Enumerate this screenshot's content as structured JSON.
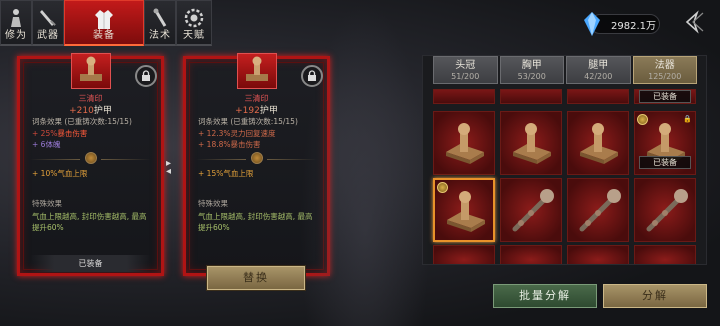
{
  "nav": {
    "tabs": [
      {
        "label": "修为",
        "icon": "figure-icon"
      },
      {
        "label": "武器",
        "icon": "sword-icon"
      },
      {
        "label": "装备",
        "icon": "robe-icon"
      },
      {
        "label": "法术",
        "icon": "staff-icon"
      },
      {
        "label": "天赋",
        "icon": "gear-icon"
      }
    ],
    "active_index": 2
  },
  "currency": {
    "amount": "2982.1万",
    "icon": "blue-crystal-icon"
  },
  "cards": [
    {
      "name": "三清印",
      "armor_value": "+210",
      "armor_label": "护甲",
      "affix_header": "词条效果 (已重铸次数:15/15)",
      "stat1_prefix": "+ 25%",
      "stat1_em": "暴击伤害",
      "stat2": "+ 6体魄",
      "set_bonus": "+ 10%气血上限",
      "special_header": "特殊效果",
      "special_desc": "气血上限越高, 封印伤害越高, 最高提升60%",
      "equipped_label": "已装备"
    },
    {
      "name": "三清印",
      "armor_value": "+192",
      "armor_label": "护甲",
      "affix_header": "词条效果 (已重铸次数:15/15)",
      "stat1_prefix": "+ 12.3%灵力回复速度",
      "stat1_em": "",
      "stat2": "+ 18.8%暴击伤害",
      "set_bonus": "+ 15%气血上限",
      "special_header": "特殊效果",
      "special_desc": "气血上限越高, 封印伤害越高, 最高提升60%",
      "equipped_label": ""
    }
  ],
  "equip_button": "替换",
  "inventory": {
    "tabs": [
      {
        "title": "头冠",
        "count": "51/200"
      },
      {
        "title": "胸甲",
        "count": "53/200"
      },
      {
        "title": "腿甲",
        "count": "42/200"
      },
      {
        "title": "法器",
        "count": "125/200"
      }
    ],
    "selected_tab": 3,
    "equipped_badge": "已装备"
  },
  "buttons": {
    "batch_decompose": "批量分解",
    "decompose": "分解"
  },
  "colors": {
    "accent_red": "#b01414",
    "gold": "#e4a23a",
    "green_text": "#a7c06a"
  }
}
